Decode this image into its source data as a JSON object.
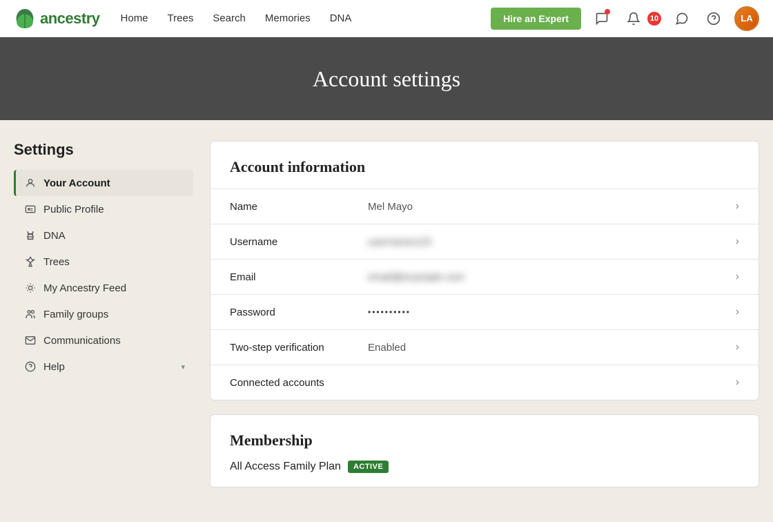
{
  "site": {
    "logo_text": "ancestry",
    "avatar_initials": "LA"
  },
  "navbar": {
    "nav_items": [
      {
        "id": "home",
        "label": "Home"
      },
      {
        "id": "trees",
        "label": "Trees"
      },
      {
        "id": "search",
        "label": "Search"
      },
      {
        "id": "memories",
        "label": "Memories"
      },
      {
        "id": "dna",
        "label": "DNA"
      }
    ],
    "hire_label": "Hire an Expert",
    "notification_count": "10"
  },
  "hero": {
    "title": "Account settings"
  },
  "sidebar": {
    "section_title": "Settings",
    "items": [
      {
        "id": "your-account",
        "label": "Your Account",
        "icon": "person",
        "active": true
      },
      {
        "id": "public-profile",
        "label": "Public Profile",
        "icon": "id-card",
        "active": false
      },
      {
        "id": "dna",
        "label": "DNA",
        "icon": "dna",
        "active": false
      },
      {
        "id": "trees",
        "label": "Trees",
        "icon": "tree",
        "active": false
      },
      {
        "id": "my-ancestry-feed",
        "label": "My Ancestry Feed",
        "icon": "feed",
        "active": false
      },
      {
        "id": "family-groups",
        "label": "Family groups",
        "icon": "group",
        "active": false
      },
      {
        "id": "communications",
        "label": "Communications",
        "icon": "envelope",
        "active": false
      },
      {
        "id": "help",
        "label": "Help",
        "icon": "help",
        "active": false
      }
    ]
  },
  "account_info": {
    "section_title": "Account information",
    "rows": [
      {
        "id": "name",
        "label": "Name",
        "value": "Mel Mayo",
        "blurred": false,
        "password": false
      },
      {
        "id": "username",
        "label": "Username",
        "value": "username",
        "blurred": true,
        "password": false
      },
      {
        "id": "email",
        "label": "Email",
        "value": "email@example.com",
        "blurred": true,
        "password": false
      },
      {
        "id": "password",
        "label": "Password",
        "value": "••••••••••",
        "blurred": false,
        "password": true
      },
      {
        "id": "two-step",
        "label": "Two-step verification",
        "value": "Enabled",
        "blurred": false,
        "password": false
      },
      {
        "id": "connected",
        "label": "Connected accounts",
        "value": "",
        "blurred": false,
        "password": false
      }
    ]
  },
  "membership": {
    "section_title": "Membership",
    "plan_name": "All Access Family Plan",
    "active_badge": "ACTIVE"
  },
  "icons": {
    "person": "○",
    "id_card": "⊡",
    "dna": "⚙",
    "tree": "⊛",
    "feed": "⊞",
    "group": "⊞",
    "envelope": "✉",
    "help": "?",
    "bell": "🔔",
    "chat": "💬",
    "message": "✉",
    "question": "?",
    "chevron_right": "›"
  }
}
